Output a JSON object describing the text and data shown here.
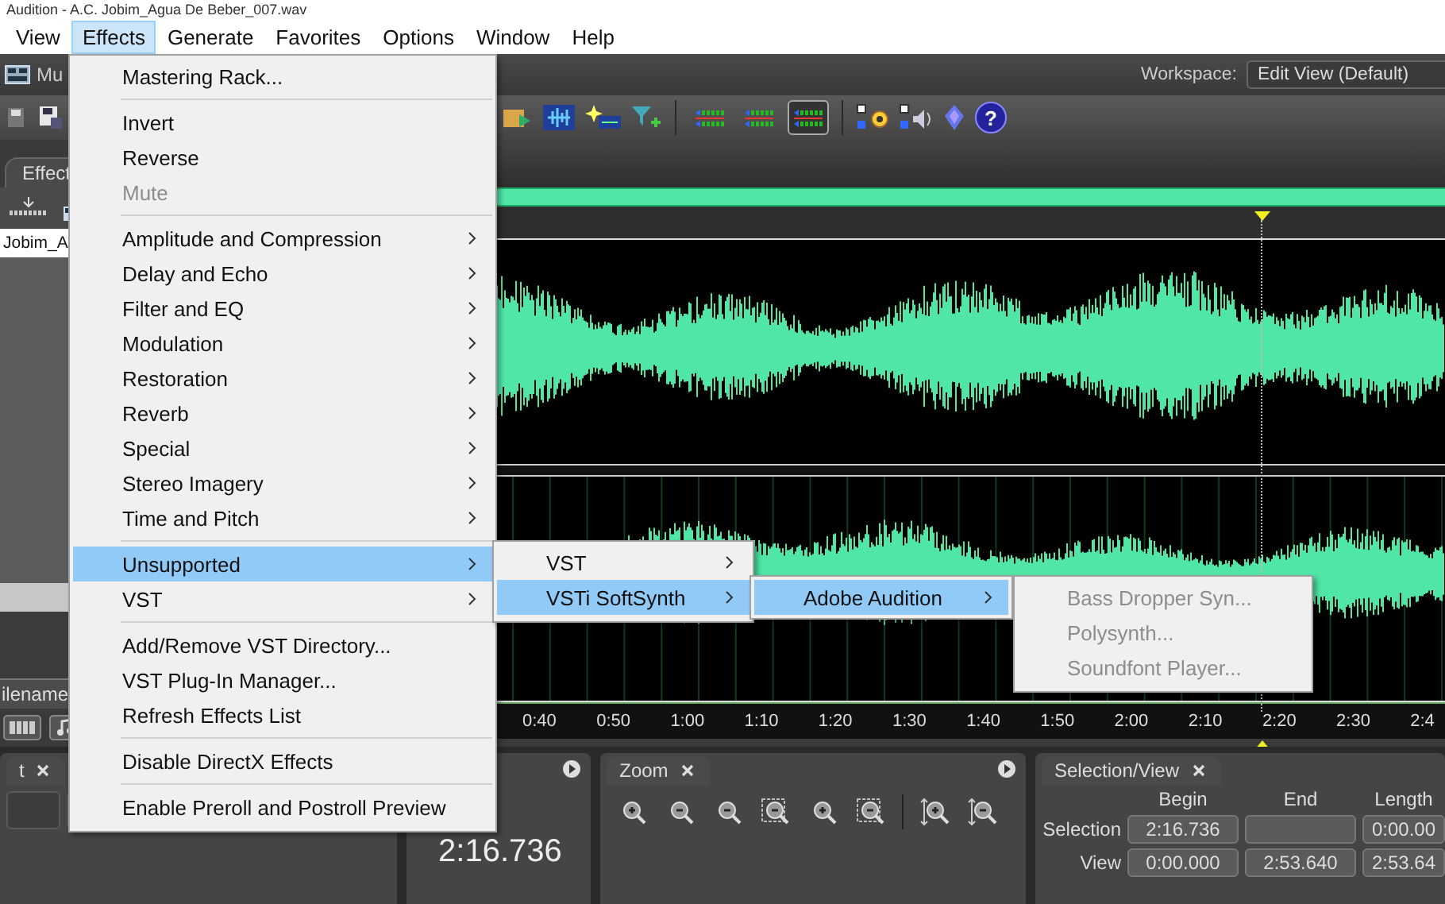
{
  "title_bar": {
    "title": "Audition - A.C. Jobim_Agua De Beber_007.wav"
  },
  "menu_bar": [
    {
      "label": "View",
      "selected": false
    },
    {
      "label": "Effects",
      "selected": true
    },
    {
      "label": "Generate",
      "selected": false
    },
    {
      "label": "Favorites",
      "selected": false
    },
    {
      "label": "Options",
      "selected": false
    },
    {
      "label": "Window",
      "selected": false
    },
    {
      "label": "Help",
      "selected": false
    }
  ],
  "toolbar_top": {
    "panel_label": "Mu",
    "workspace_label": "Workspace:",
    "workspace_value": "Edit View (Default)"
  },
  "toolbar": {
    "toggles": [
      {
        "on": false
      },
      {
        "on": false
      },
      {
        "on": true
      }
    ],
    "help_glyph": "?"
  },
  "left_panel": {
    "tab": "Effect",
    "file": "Jobim_A",
    "column_header": "ilename",
    "bottom_tab": "t"
  },
  "timeline": {
    "labels": [
      "0:40",
      "0:50",
      "1:00",
      "1:10",
      "1:20",
      "1:30",
      "1:40",
      "1:50",
      "2:00",
      "2:10",
      "2:20",
      "2:30",
      "2:4"
    ]
  },
  "time_display": "2:16.736",
  "zoom_panel": {
    "tab": "Zoom"
  },
  "selection_panel": {
    "tab": "Selection/View",
    "columns": [
      "Begin",
      "End",
      "Length"
    ],
    "rows": [
      {
        "label": "Selection",
        "begin": "2:16.736",
        "length": "0:00.00"
      },
      {
        "label": "View",
        "begin": "0:00.000",
        "end": "2:53.640",
        "length": "2:53.64"
      }
    ]
  },
  "effects_menu": [
    {
      "kind": "item",
      "label": "Mastering Rack...",
      "disabled": false,
      "submenu": false,
      "selected": false
    },
    {
      "kind": "separator"
    },
    {
      "kind": "item",
      "label": "Invert",
      "disabled": false,
      "submenu": false,
      "selected": false
    },
    {
      "kind": "item",
      "label": "Reverse",
      "disabled": false,
      "submenu": false,
      "selected": false
    },
    {
      "kind": "item",
      "label": "Mute",
      "disabled": true,
      "submenu": false,
      "selected": false
    },
    {
      "kind": "separator"
    },
    {
      "kind": "item",
      "label": "Amplitude and Compression",
      "disabled": false,
      "submenu": true,
      "selected": false
    },
    {
      "kind": "item",
      "label": "Delay and Echo",
      "disabled": false,
      "submenu": true,
      "selected": false
    },
    {
      "kind": "item",
      "label": "Filter and EQ",
      "disabled": false,
      "submenu": true,
      "selected": false
    },
    {
      "kind": "item",
      "label": "Modulation",
      "disabled": false,
      "submenu": true,
      "selected": false
    },
    {
      "kind": "item",
      "label": "Restoration",
      "disabled": false,
      "submenu": true,
      "selected": false
    },
    {
      "kind": "item",
      "label": "Reverb",
      "disabled": false,
      "submenu": true,
      "selected": false
    },
    {
      "kind": "item",
      "label": "Special",
      "disabled": false,
      "submenu": true,
      "selected": false
    },
    {
      "kind": "item",
      "label": "Stereo Imagery",
      "disabled": false,
      "submenu": true,
      "selected": false
    },
    {
      "kind": "item",
      "label": "Time and Pitch",
      "disabled": false,
      "submenu": true,
      "selected": false
    },
    {
      "kind": "separator"
    },
    {
      "kind": "item",
      "label": "Unsupported",
      "disabled": false,
      "submenu": true,
      "selected": true
    },
    {
      "kind": "item",
      "label": "VST",
      "disabled": false,
      "submenu": true,
      "selected": false
    },
    {
      "kind": "separator"
    },
    {
      "kind": "item",
      "label": "Add/Remove VST Directory...",
      "disabled": false,
      "submenu": false,
      "selected": false
    },
    {
      "kind": "item",
      "label": "VST Plug-In Manager...",
      "disabled": false,
      "submenu": false,
      "selected": false
    },
    {
      "kind": "item",
      "label": "Refresh Effects List",
      "disabled": false,
      "submenu": false,
      "selected": false
    },
    {
      "kind": "separator"
    },
    {
      "kind": "item",
      "label": "Disable DirectX Effects",
      "disabled": false,
      "submenu": false,
      "selected": false
    },
    {
      "kind": "separator"
    },
    {
      "kind": "item",
      "label": "Enable Preroll and Postroll Preview",
      "disabled": false,
      "submenu": false,
      "selected": false
    }
  ],
  "submenus": [
    {
      "items": [
        {
          "kind": "item",
          "label": "VST",
          "disabled": false,
          "submenu": true,
          "selected": false
        },
        {
          "kind": "item",
          "label": "VSTi SoftSynth",
          "disabled": false,
          "submenu": true,
          "selected": true
        }
      ]
    },
    {
      "items": [
        {
          "kind": "item",
          "label": "Adobe Audition",
          "disabled": false,
          "submenu": true,
          "selected": true
        }
      ]
    },
    {
      "items": [
        {
          "kind": "item",
          "label": "Bass Dropper Syn...",
          "disabled": true,
          "submenu": false,
          "selected": false
        },
        {
          "kind": "item",
          "label": "Polysynth...",
          "disabled": true,
          "submenu": false,
          "selected": false
        },
        {
          "kind": "item",
          "label": "Soundfont Player...",
          "disabled": true,
          "submenu": false,
          "selected": false
        }
      ]
    }
  ]
}
